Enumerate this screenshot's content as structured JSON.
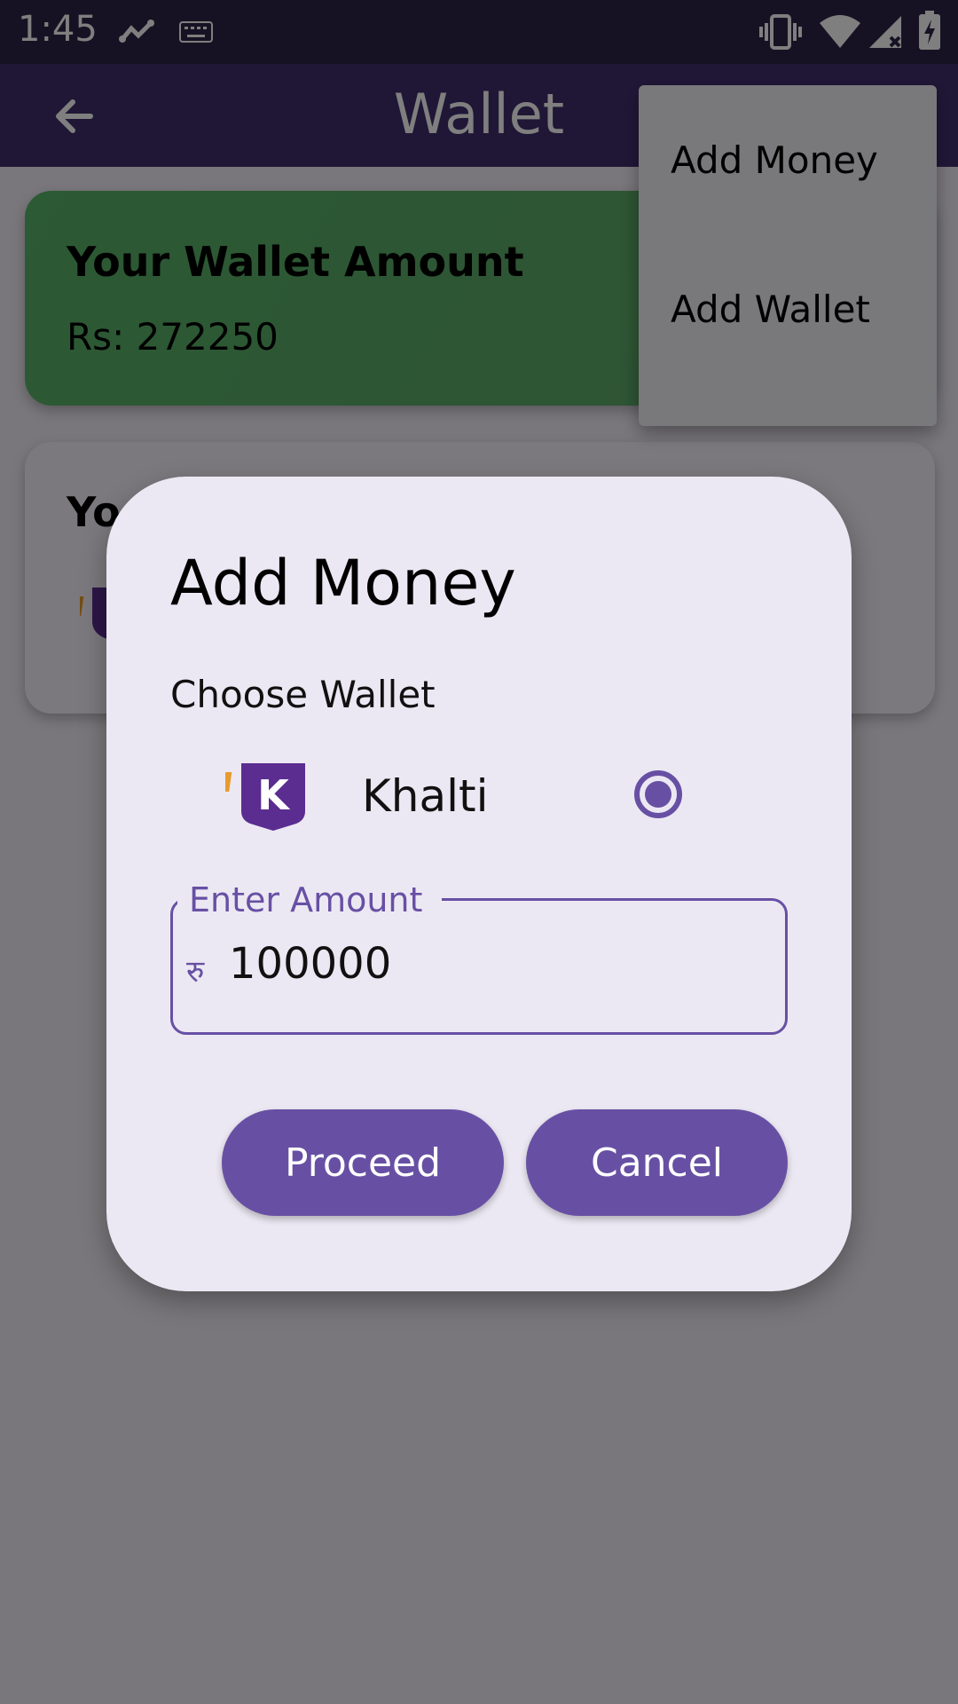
{
  "status_bar": {
    "time": "1:45",
    "icons": [
      "analytics-icon",
      "keyboard-icon",
      "vibrate-icon",
      "wifi-icon",
      "signal-icon",
      "battery-icon"
    ]
  },
  "app_bar": {
    "title": "Wallet",
    "back_icon": "arrow-back-icon"
  },
  "wallet_card": {
    "title": "Your Wallet Amount",
    "amount": "Rs: 272250"
  },
  "wallets_card": {
    "title_partial": "Yo"
  },
  "popup_menu": {
    "items": [
      {
        "label": "Add Money"
      },
      {
        "label": "Add Wallet"
      }
    ]
  },
  "dialog": {
    "title": "Add Money",
    "choose_label": "Choose Wallet",
    "wallet_option": {
      "name": "Khalti",
      "logo_letter": "K",
      "selected": true
    },
    "amount_field": {
      "label": "Enter Amount",
      "currency_symbol": "रु",
      "value": "100000"
    },
    "buttons": {
      "proceed": "Proceed",
      "cancel": "Cancel"
    }
  },
  "colors": {
    "status_bar": "#2e2547",
    "app_bar": "#412f6e",
    "primary": "#6750a4",
    "wallet_card": "#58b468",
    "dialog_bg": "#ece8f3"
  }
}
